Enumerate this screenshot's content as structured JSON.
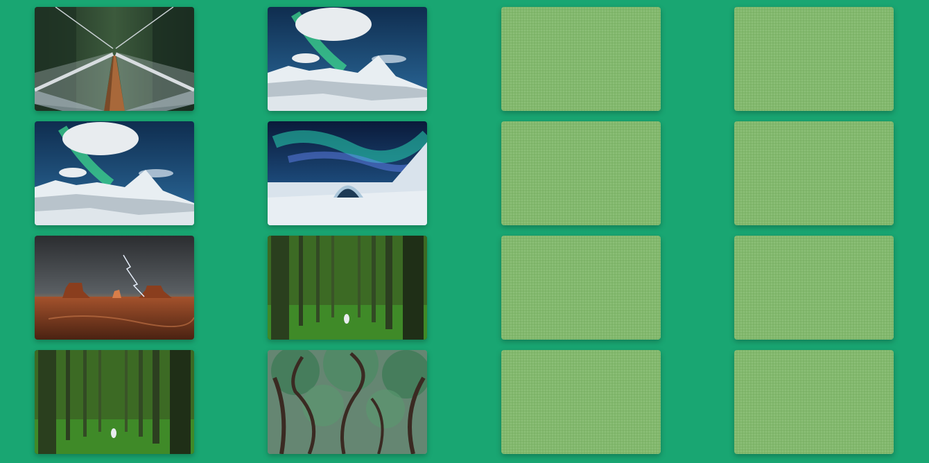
{
  "board": {
    "columns": 4,
    "rows": 4,
    "card_back_color": "#82b96d",
    "background_color": "#19a672"
  },
  "cards": [
    {
      "state": "face-up",
      "picture": "suspension-bridge-forest"
    },
    {
      "state": "face-up",
      "picture": "aurora-snowy-mountains"
    },
    {
      "state": "face-down"
    },
    {
      "state": "face-down"
    },
    {
      "state": "face-up",
      "picture": "aurora-snowy-mountains"
    },
    {
      "state": "face-up",
      "picture": "aurora-ice-hotel"
    },
    {
      "state": "face-down"
    },
    {
      "state": "face-down"
    },
    {
      "state": "face-up",
      "picture": "desert-buttes-lightning"
    },
    {
      "state": "face-up",
      "picture": "pine-forest-figure"
    },
    {
      "state": "face-down"
    },
    {
      "state": "face-down"
    },
    {
      "state": "face-up",
      "picture": "pine-forest-figure"
    },
    {
      "state": "face-up",
      "picture": "twisted-tree-canopy"
    },
    {
      "state": "face-down"
    },
    {
      "state": "face-down"
    }
  ]
}
